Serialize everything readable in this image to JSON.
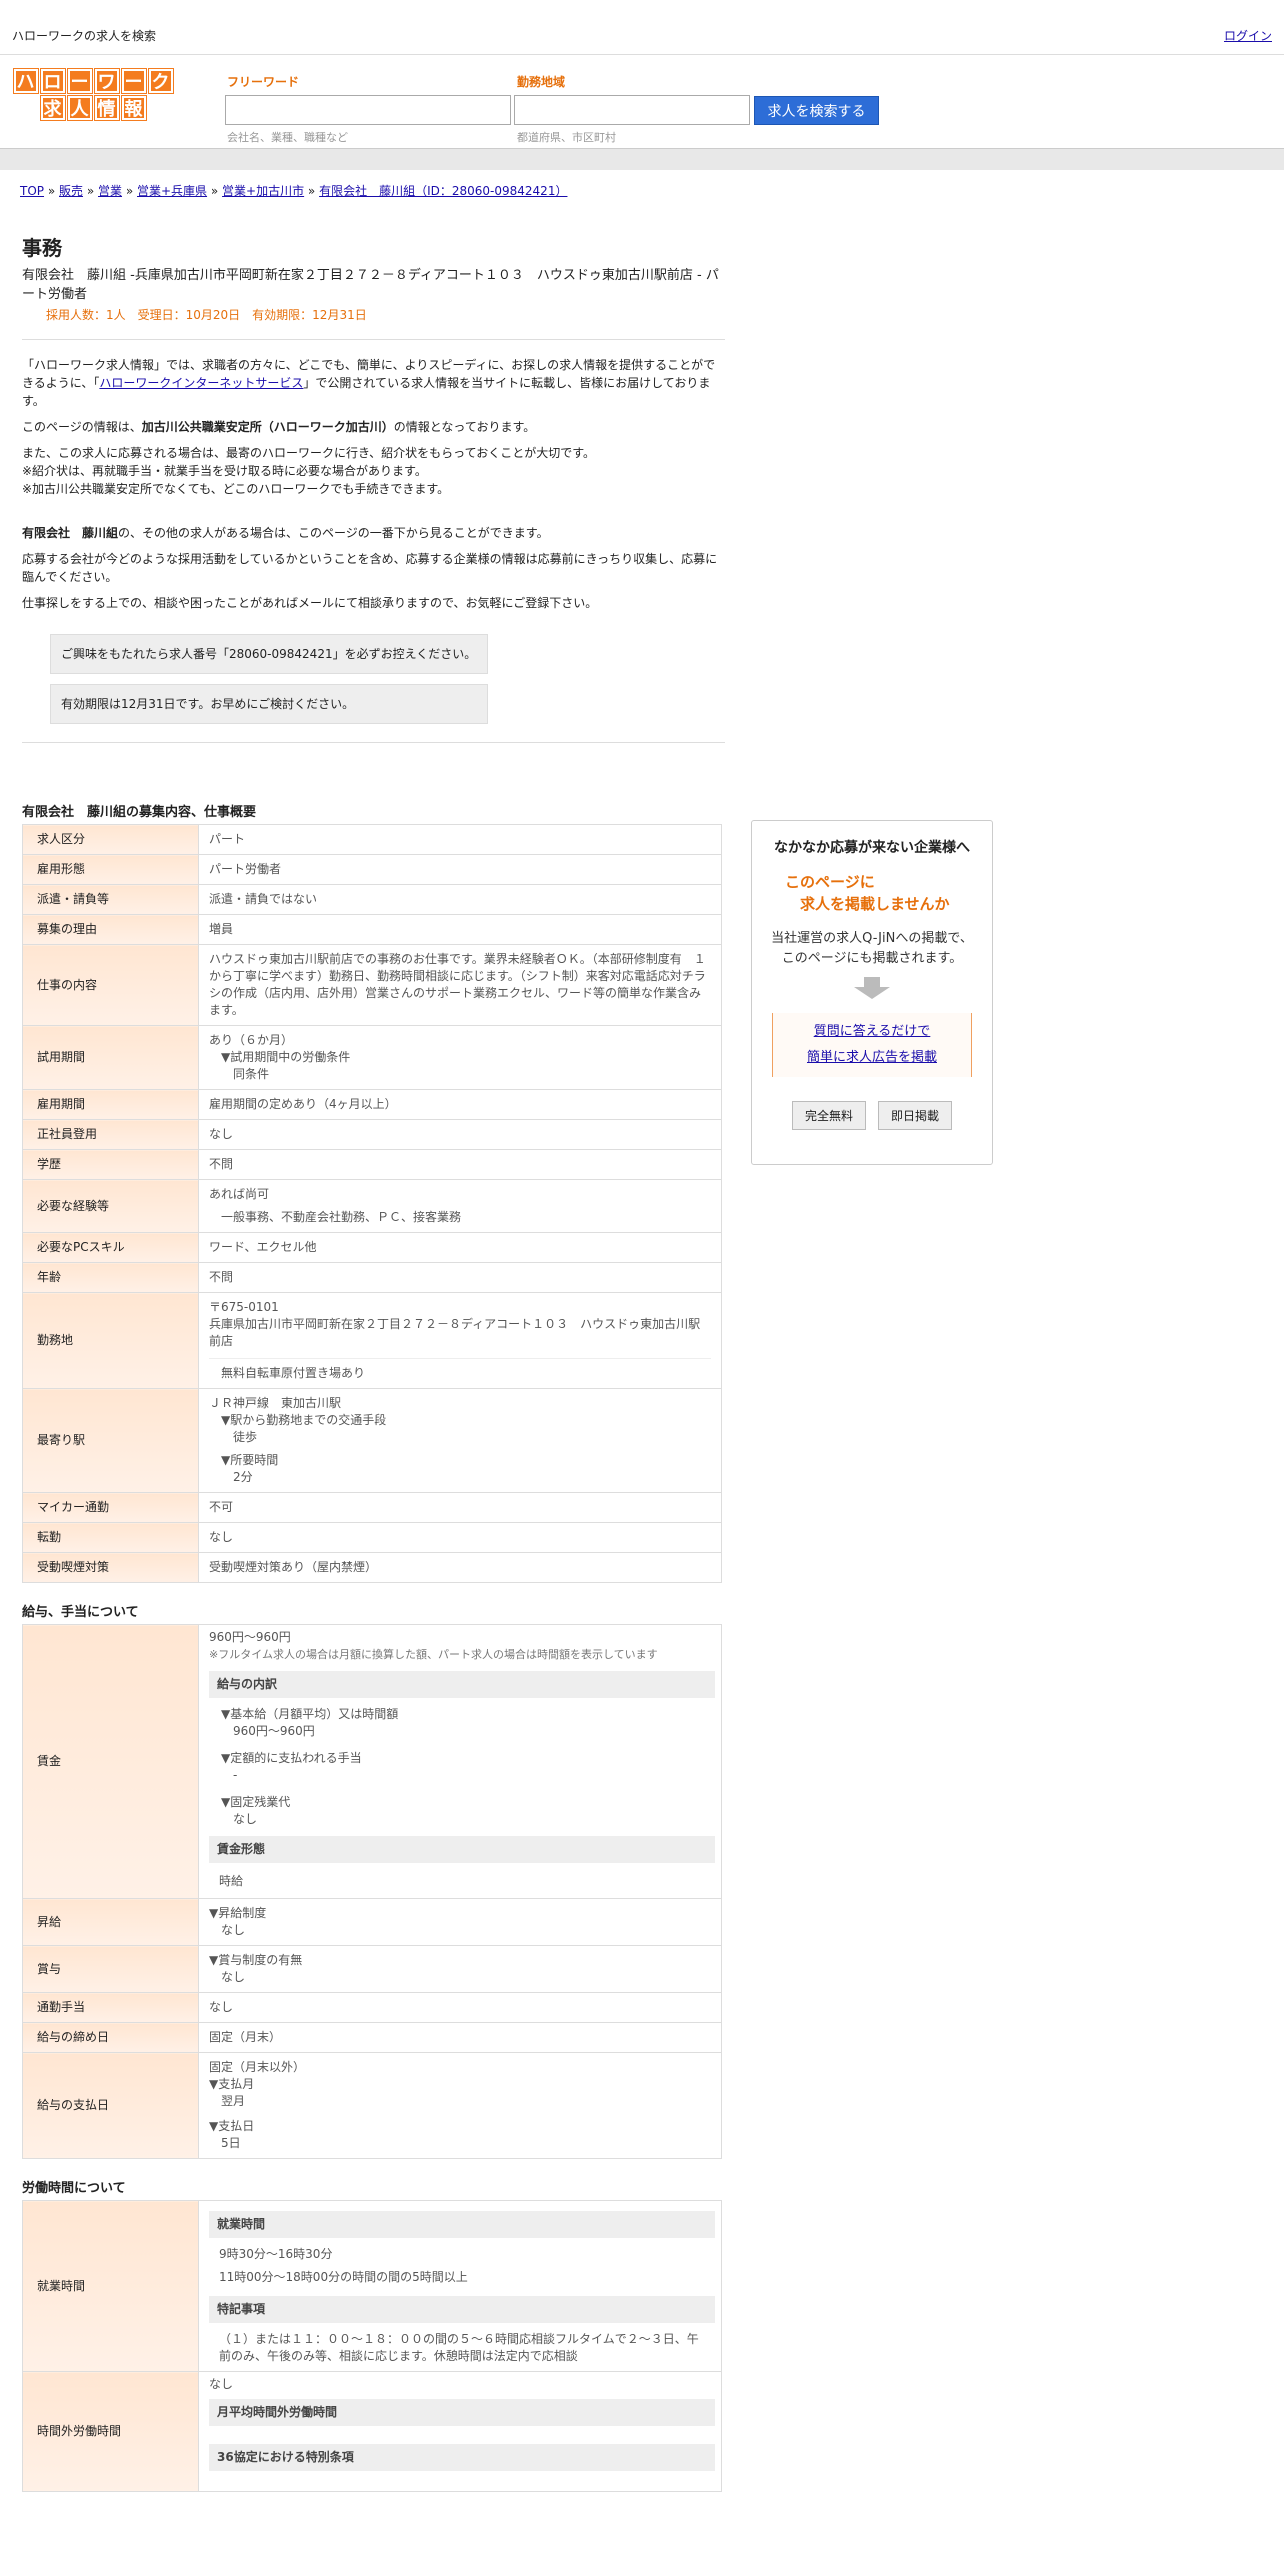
{
  "top": {
    "title": "ハローワークの求人を検索",
    "login": "ログイン"
  },
  "logo": {
    "row1": [
      "ハ",
      "ロ",
      "ー",
      "ワ",
      "ー",
      "ク"
    ],
    "row2": [
      "求",
      "人",
      "情",
      "報"
    ]
  },
  "search": {
    "free_label": "フリーワード",
    "free_ph": "会社名、業種、職種など",
    "area_label": "勤務地域",
    "area_ph": "都道府県、市区町村",
    "button": "求人を検索する"
  },
  "breadcrumb": [
    "TOP",
    "販売",
    "営業",
    "営業+兵庫県",
    "営業+加古川市",
    "有限会社　藤川組（ID：28060-09842421）"
  ],
  "job": {
    "title": "事務",
    "subtitle": "有限会社　藤川組 -兵庫県加古川市平岡町新在家２丁目２７２－８ディアコート１０３　ハウスドゥ東加古川駅前店 - パート労働者",
    "meta": "採用人数：1人　受理日：10月20日　有効期限：12月31日"
  },
  "intro": {
    "p1a": "「ハローワーク求人情報」では、求職者の方々に、どこでも、簡単に、よりスピーディに、お探しの求人情報を提供することができるように、「",
    "p1link": "ハローワークインターネットサービス",
    "p1b": "」で公開されている求人情報を当サイトに転載し、皆様にお届けしております。",
    "p2a": "このページの情報は、",
    "p2b": "加古川公共職業安定所（ハローワーク加古川）",
    "p2c": "の情報となっております。",
    "p3": [
      "また、この求人に応募される場合は、最寄のハローワークに行き、紹介状をもらっておくことが大切です。",
      "※紹介状は、再就職手当・就業手当を受け取る時に必要な場合があります。",
      "※加古川公共職業安定所でなくても、どこのハローワークでも手続きできます。"
    ],
    "p4a": "有限会社　藤川組",
    "p4b": "の、その他の求人がある場合は、このページの一番下から見ることができます。",
    "p5": "応募する会社が今どのような採用活動をしているかということを含め、応募する企業様の情報は応募前にきっちり収集し、応募に臨んでください。",
    "p6": "仕事探しをする上での、相談や困ったことがあればメールにて相談承りますので、お気軽にご登録下さい。",
    "box1": "ご興味をもたれたら求人番号「28060-09842421」を必ずお控えください。",
    "box2": "有効期限は12月31日です。お早めにご検討ください。"
  },
  "sec1": {
    "title": "有限会社　藤川組の募集内容、仕事概要",
    "rows": [
      [
        "求人区分",
        "パート"
      ],
      [
        "雇用形態",
        "パート労働者"
      ],
      [
        "派遣・請負等",
        "派遣・請負ではない"
      ],
      [
        "募集の理由",
        "増員"
      ],
      [
        "仕事の内容",
        "ハウスドゥ東加古川駅前店での事務のお仕事です。業界未経験者ＯＫ。（本部研修制度有　１から丁寧に学べます）勤務日、勤務時間相談に応じます。（シフト制）来客対応電話応対チラシの作成（店内用、店外用）営業さんのサポート業務エクセル、ワード等の簡単な作業含みます。"
      ]
    ],
    "trial": {
      "k": "試用期間",
      "v1": "あり（６か月）",
      "v2": "▼試用期間中の労働条件",
      "v3": "同条件"
    },
    "rows2": [
      [
        "雇用期間",
        "雇用期間の定めあり（4ヶ月以上）"
      ],
      [
        "正社員登用",
        "なし"
      ],
      [
        "学歴",
        "不問"
      ]
    ],
    "exp": {
      "k": "必要な経験等",
      "v1": "あれば尚可",
      "v2": "一般事務、不動産会社勤務、ＰＣ、接客業務"
    },
    "rows3": [
      [
        "必要なPCスキル",
        "ワード、エクセル他"
      ],
      [
        "年齢",
        "不問"
      ]
    ],
    "loc": {
      "k": "勤務地",
      "v1": "〒675-0101",
      "v2": "兵庫県加古川市平岡町新在家２丁目２７２－８ディアコート１０３　ハウスドゥ東加古川駅前店",
      "v3": "無料自転車原付置き場あり"
    },
    "sta": {
      "k": "最寄り駅",
      "v1": "ＪＲ神戸線　東加古川駅",
      "v2": "▼駅から勤務地までの交通手段",
      "v3": "徒歩",
      "v4": "▼所要時間",
      "v5": "2分"
    },
    "rows4": [
      [
        "マイカー通勤",
        "不可"
      ],
      [
        "転勤",
        "なし"
      ],
      [
        "受動喫煙対策",
        "受動喫煙対策あり（屋内禁煙）"
      ]
    ]
  },
  "sec2": {
    "title": "給与、手当について",
    "wage": {
      "k": "賃金",
      "v1": "960円〜960円",
      "note": "※フルタイム求人の場合は月額に換算した額、パート求人の場合は時間額を表示しています",
      "bar1": "給与の内訳",
      "a1": "▼基本給（月額平均）又は時間額",
      "a2": "960円〜960円",
      "b1": "▼定額的に支払われる手当",
      "b2": "-",
      "c1": "▼固定残業代",
      "c2": "なし",
      "bar2": "賃金形態",
      "d": "時給"
    },
    "raise": {
      "k": "昇給",
      "v1": "▼昇給制度",
      "v2": "なし"
    },
    "bonus": {
      "k": "賞与",
      "v1": "▼賞与制度の有無",
      "v2": "なし"
    },
    "rows": [
      [
        "通勤手当",
        "なし"
      ],
      [
        "給与の締め日",
        "固定（月末）"
      ]
    ],
    "pay": {
      "k": "給与の支払日",
      "v1": "固定（月末以外）",
      "v2": "▼支払月",
      "v3": "翌月",
      "v4": "▼支払日",
      "v5": "5日"
    }
  },
  "sec3": {
    "title": "労働時間について",
    "hours": {
      "k": "就業時間",
      "bar1": "就業時間",
      "h1": "9時30分〜16時30分",
      "h2": "11時00分〜18時00分の時間の間の5時間以上",
      "bar2": "特記事項",
      "note": "（１）または１１：００～１８：００の間の５～６時間応相談フルタイムで２～３日、午前のみ、午後のみ等、相談に応じます。休憩時間は法定内で応相談"
    },
    "ot": {
      "k": "時間外労働時間",
      "v1": "なし",
      "bar1": "月平均時間外労働時間",
      "bar2": "36協定における特別条項"
    }
  },
  "side": {
    "title": "なかなか応募が来ない企業様へ",
    "orange1": "このページに",
    "orange2": "求人を掲載しませんか",
    "text1": "当社運営の求人Q-JiNへの掲載で、",
    "text2": "このページにも掲載されます。",
    "link1": "質問に答えるだけで",
    "link2": "簡単に求人広告を掲載",
    "btn1": "完全無料",
    "btn2": "即日掲載"
  },
  "colors": {
    "accent": "#e6700c",
    "button": "#2d6dd7",
    "label_bg": "#ffeee0"
  }
}
